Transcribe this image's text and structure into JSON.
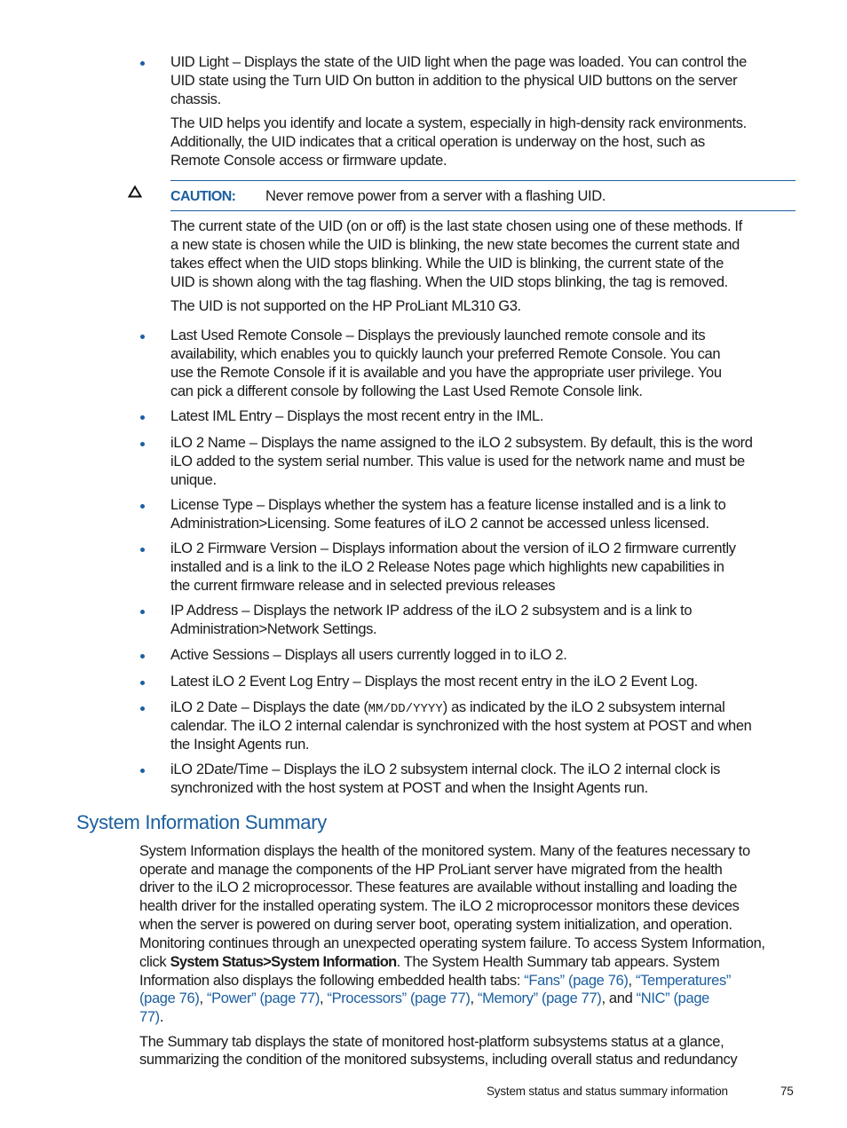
{
  "bullets_part1": [
    {
      "lines": [
        "UID Light – Displays the state of the UID light when the page was loaded. You can control the",
        "UID state using the Turn UID On button in addition to the physical UID buttons on the server",
        "chassis."
      ]
    }
  ],
  "uid_paragraph": [
    "The UID helps you identify and locate a system, especially in high-density rack environments.",
    "Additionally, the UID indicates that a critical operation is underway on the host, such as",
    "Remote Console access or firmware update."
  ],
  "caution": {
    "icon": "caution-triangle-icon",
    "label": "CAUTION:",
    "text": "Never remove power from a server with a flashing UID."
  },
  "uid_state_paragraph": [
    "The current state of the UID (on or off) is the last state chosen using one of these methods. If",
    "a new state is chosen while the UID is blinking, the new state becomes the current state and",
    "takes effect when the UID stops blinking. While the UID is blinking, the current state of the",
    "UID is shown along with the tag flashing. When the UID stops blinking, the tag is removed."
  ],
  "uid_not_supported": "The UID is not supported on the HP ProLiant ML310 G3.",
  "bullets": [
    {
      "lines": [
        "Last Used Remote Console – Displays the previously launched remote console and its",
        "availability, which enables you to quickly launch your preferred Remote Console. You can",
        "use the Remote Console if it is available and you have the appropriate user privilege. You",
        "can pick a different console by following the Last Used Remote Console link."
      ]
    },
    {
      "lines": [
        "Latest IML Entry – Displays the most recent entry in the IML."
      ]
    },
    {
      "lines": [
        "iLO 2 Name – Displays the name assigned to the iLO 2 subsystem. By default, this is the word",
        "iLO added to the system serial number. This value is used for the network name and must be",
        "unique."
      ]
    },
    {
      "lines": [
        "License Type – Displays whether the system has a feature license installed and is a link to",
        "Administration>Licensing. Some features of iLO 2 cannot be accessed unless licensed."
      ]
    },
    {
      "lines": [
        "iLO 2 Firmware Version – Displays information about the version of iLO 2 firmware currently",
        "installed and is a link to the iLO 2 Release Notes page which highlights new capabilities in",
        "the current firmware release and in selected previous releases"
      ]
    },
    {
      "lines": [
        "IP Address – Displays the network IP address of the iLO 2 subsystem and is a link to",
        "Administration>Network Settings."
      ]
    },
    {
      "lines": [
        "Active Sessions – Displays all users currently logged in to iLO 2."
      ]
    },
    {
      "lines": [
        "Latest iLO 2 Event Log Entry – Displays the most recent entry in the iLO 2 Event Log."
      ]
    }
  ],
  "ilo_date": {
    "line1_before": "iLO 2 Date – Displays the date (",
    "line1_code": "MM/DD/YYYY",
    "line1_after": ") as indicated by the iLO 2 subsystem internal",
    "line2": "calendar. The iLO 2 internal calendar is synchronized with the host system at POST and when",
    "line3": "the Insight Agents run."
  },
  "ilo_datetime": [
    "iLO 2Date/Time – Displays the iLO 2 subsystem internal clock. The iLO 2 internal clock is",
    "synchronized with the host system at POST and when the Insight Agents run."
  ],
  "section": {
    "heading": "System Information Summary",
    "para1_lines": [
      "System Information displays the health of the monitored system. Many of the features necessary to",
      "operate and manage the components of the HP ProLiant server have migrated from the health",
      "driver to the iLO 2 microprocessor. These features are available without installing and loading the",
      "health driver for the installed operating system. The iLO 2 microprocessor monitors these devices",
      "when the server is powered on during server boot, operating system initialization, and operation.",
      "Monitoring continues through an unexpected operating system failure. To access System Information,"
    ],
    "click_prefix": "click ",
    "click_bold": "System Status>System Information",
    "click_suffix": ". The System Health Summary tab appears. System",
    "tabs_prefix": "Information also displays the following embedded health tabs: ",
    "links": {
      "fans": "“Fans” (page 76)",
      "temperatures_a": "“Temperatures”",
      "temperatures_b": "(page 76)",
      "power": "“Power” (page 77)",
      "processors": "“Processors” (page 77)",
      "memory": "“Memory” (page 77)",
      "nic_a": "“NIC” (page",
      "nic_b": "77)"
    },
    "sep_comma": ", ",
    "sep_and": ", and ",
    "end_period": ".",
    "para2_lines": [
      "The Summary tab displays the state of monitored host-platform subsystems status at a glance,",
      "summarizing the condition of the monitored subsystems, including overall status and redundancy"
    ]
  },
  "footer": {
    "chapter": "System status and status summary information",
    "page_number": "75"
  },
  "colors": {
    "accent": "#1c5fa0",
    "text": "#1a1a1a"
  }
}
